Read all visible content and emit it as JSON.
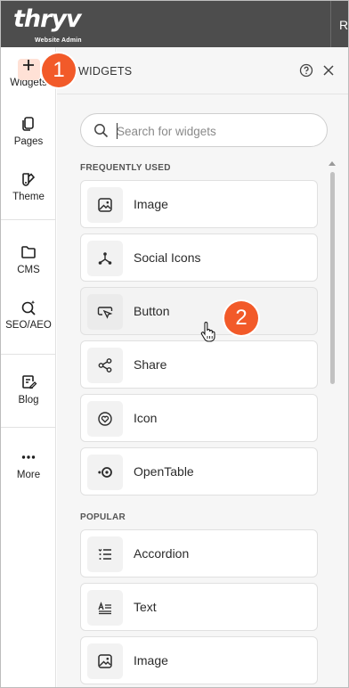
{
  "topbar": {
    "logo_text": "thryv",
    "logo_subtitle": "Website Admin",
    "right_text": "Ro"
  },
  "rail": {
    "items": [
      {
        "label": "Widgets",
        "icon": "plus-icon"
      },
      {
        "label": "Pages",
        "icon": "pages-icon"
      },
      {
        "label": "Theme",
        "icon": "theme-icon"
      },
      {
        "label": "CMS",
        "icon": "folder-icon"
      },
      {
        "label": "SEO/AEO",
        "icon": "seo-icon"
      },
      {
        "label": "Blog",
        "icon": "blog-icon"
      },
      {
        "label": "More",
        "icon": "more-icon"
      }
    ]
  },
  "badges": {
    "one": "1",
    "two": "2",
    "color": "#f25a29"
  },
  "panel": {
    "title": "WIDGETS",
    "search_placeholder": "Search for widgets",
    "sections": [
      {
        "label": "FREQUENTLY USED",
        "widgets": [
          {
            "label": "Image",
            "icon": "image-icon"
          },
          {
            "label": "Social Icons",
            "icon": "social-icons-icon"
          },
          {
            "label": "Button",
            "icon": "button-icon"
          },
          {
            "label": "Share",
            "icon": "share-icon"
          },
          {
            "label": "Icon",
            "icon": "heart-circle-icon"
          },
          {
            "label": "OpenTable",
            "icon": "opentable-icon"
          }
        ]
      },
      {
        "label": "POPULAR",
        "widgets": [
          {
            "label": "Accordion",
            "icon": "accordion-icon"
          },
          {
            "label": "Text",
            "icon": "text-icon"
          },
          {
            "label": "Image",
            "icon": "image-icon"
          }
        ]
      }
    ]
  }
}
